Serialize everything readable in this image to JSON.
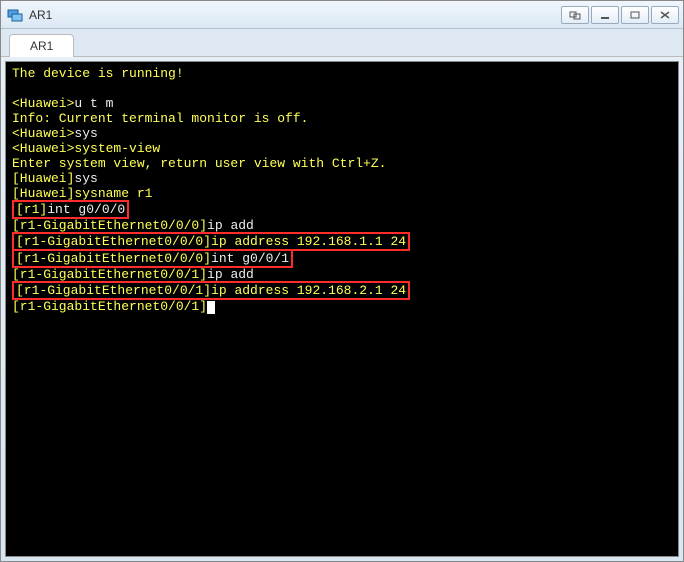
{
  "window": {
    "title": "AR1"
  },
  "tabs": [
    {
      "label": "AR1"
    }
  ],
  "lines": {
    "l0": "The device is running!",
    "l1": " ",
    "l2a": "<Huawei>",
    "l2b": "u t m",
    "l3": "Info: Current terminal monitor is off.",
    "l4a": "<Huawei>",
    "l4b": "sys",
    "l5a": "<Huawei>",
    "l5b": "system-view",
    "l6": "Enter system view, return user view with Ctrl+Z.",
    "l7a": "[Huawei]",
    "l7b": "sys",
    "l8a": "[Huawei]",
    "l8b": "sysname r1",
    "l9a": "[r1]",
    "l9b": "int g0/0/0",
    "l10a": "[r1-GigabitEthernet0/0/0]",
    "l10b": "ip add",
    "l11a": "[r1-GigabitEthernet0/0/0]",
    "l11b": "ip address 192.168.1.1 24",
    "l12a": "[r1-GigabitEthernet0/0/0]",
    "l12b": "int g0/0/1",
    "l13a": "[r1-GigabitEthernet0/0/1]",
    "l13b": "ip add",
    "l14a": "[r1-GigabitEthernet0/0/1]",
    "l14b": "ip address 192.168.2.1 24",
    "l15a": "[r1-GigabitEthernet0/0/1]"
  }
}
